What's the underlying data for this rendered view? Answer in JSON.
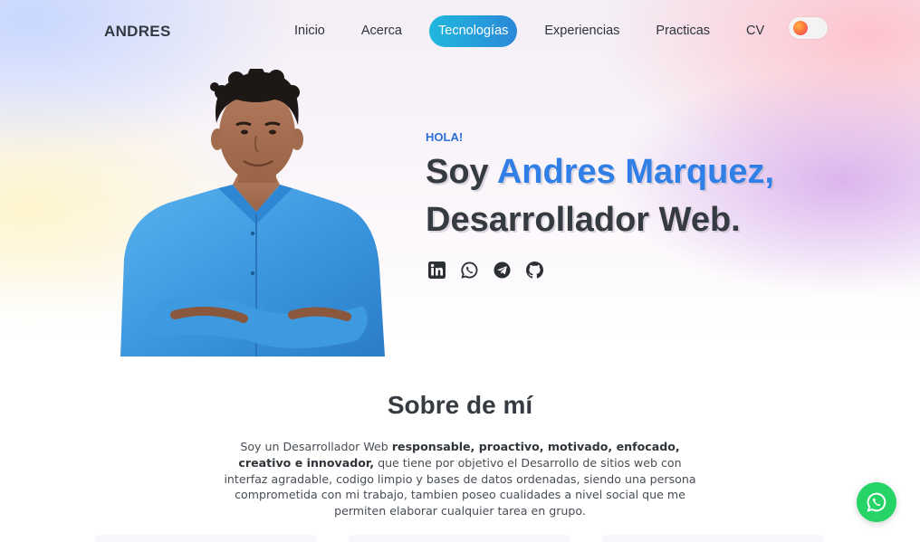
{
  "nav": {
    "brand": "ANDRES",
    "links": [
      {
        "label": "Inicio"
      },
      {
        "label": "Acerca"
      },
      {
        "label": "Tecnologías",
        "active": true
      },
      {
        "label": "Experiencias"
      },
      {
        "label": "Practicas"
      },
      {
        "label": "CV"
      }
    ],
    "theme_toggle": {
      "icon": "sun-toggle-icon",
      "state": "light"
    }
  },
  "hero": {
    "greeting": "HOLA!",
    "line1_prefix": "Soy ",
    "name": "Andres Marquez,",
    "line2": "Desarrollador Web.",
    "socials": [
      {
        "icon": "linkedin-icon"
      },
      {
        "icon": "whatsapp-icon"
      },
      {
        "icon": "telegram-icon"
      },
      {
        "icon": "github-icon"
      }
    ],
    "accent_color": "#2f7fe6"
  },
  "about": {
    "title": "Sobre de mí",
    "text_start": "Soy un Desarrollador Web ",
    "bold_traits": "responsable, proactivo, motivado, enfocado, creativo e innovador,",
    "text_rest": " que tiene por objetivo el Desarrollo de sitios web con interfaz agradable, codigo limpio y bases de datos ordenadas, siendo una persona comprometida con mi trabajo, tambien poseo cualidades a nivel social que me permiten elaborar cualquier tarea en grupo."
  },
  "floating": {
    "icon": "whatsapp-icon",
    "color": "#25d366"
  }
}
